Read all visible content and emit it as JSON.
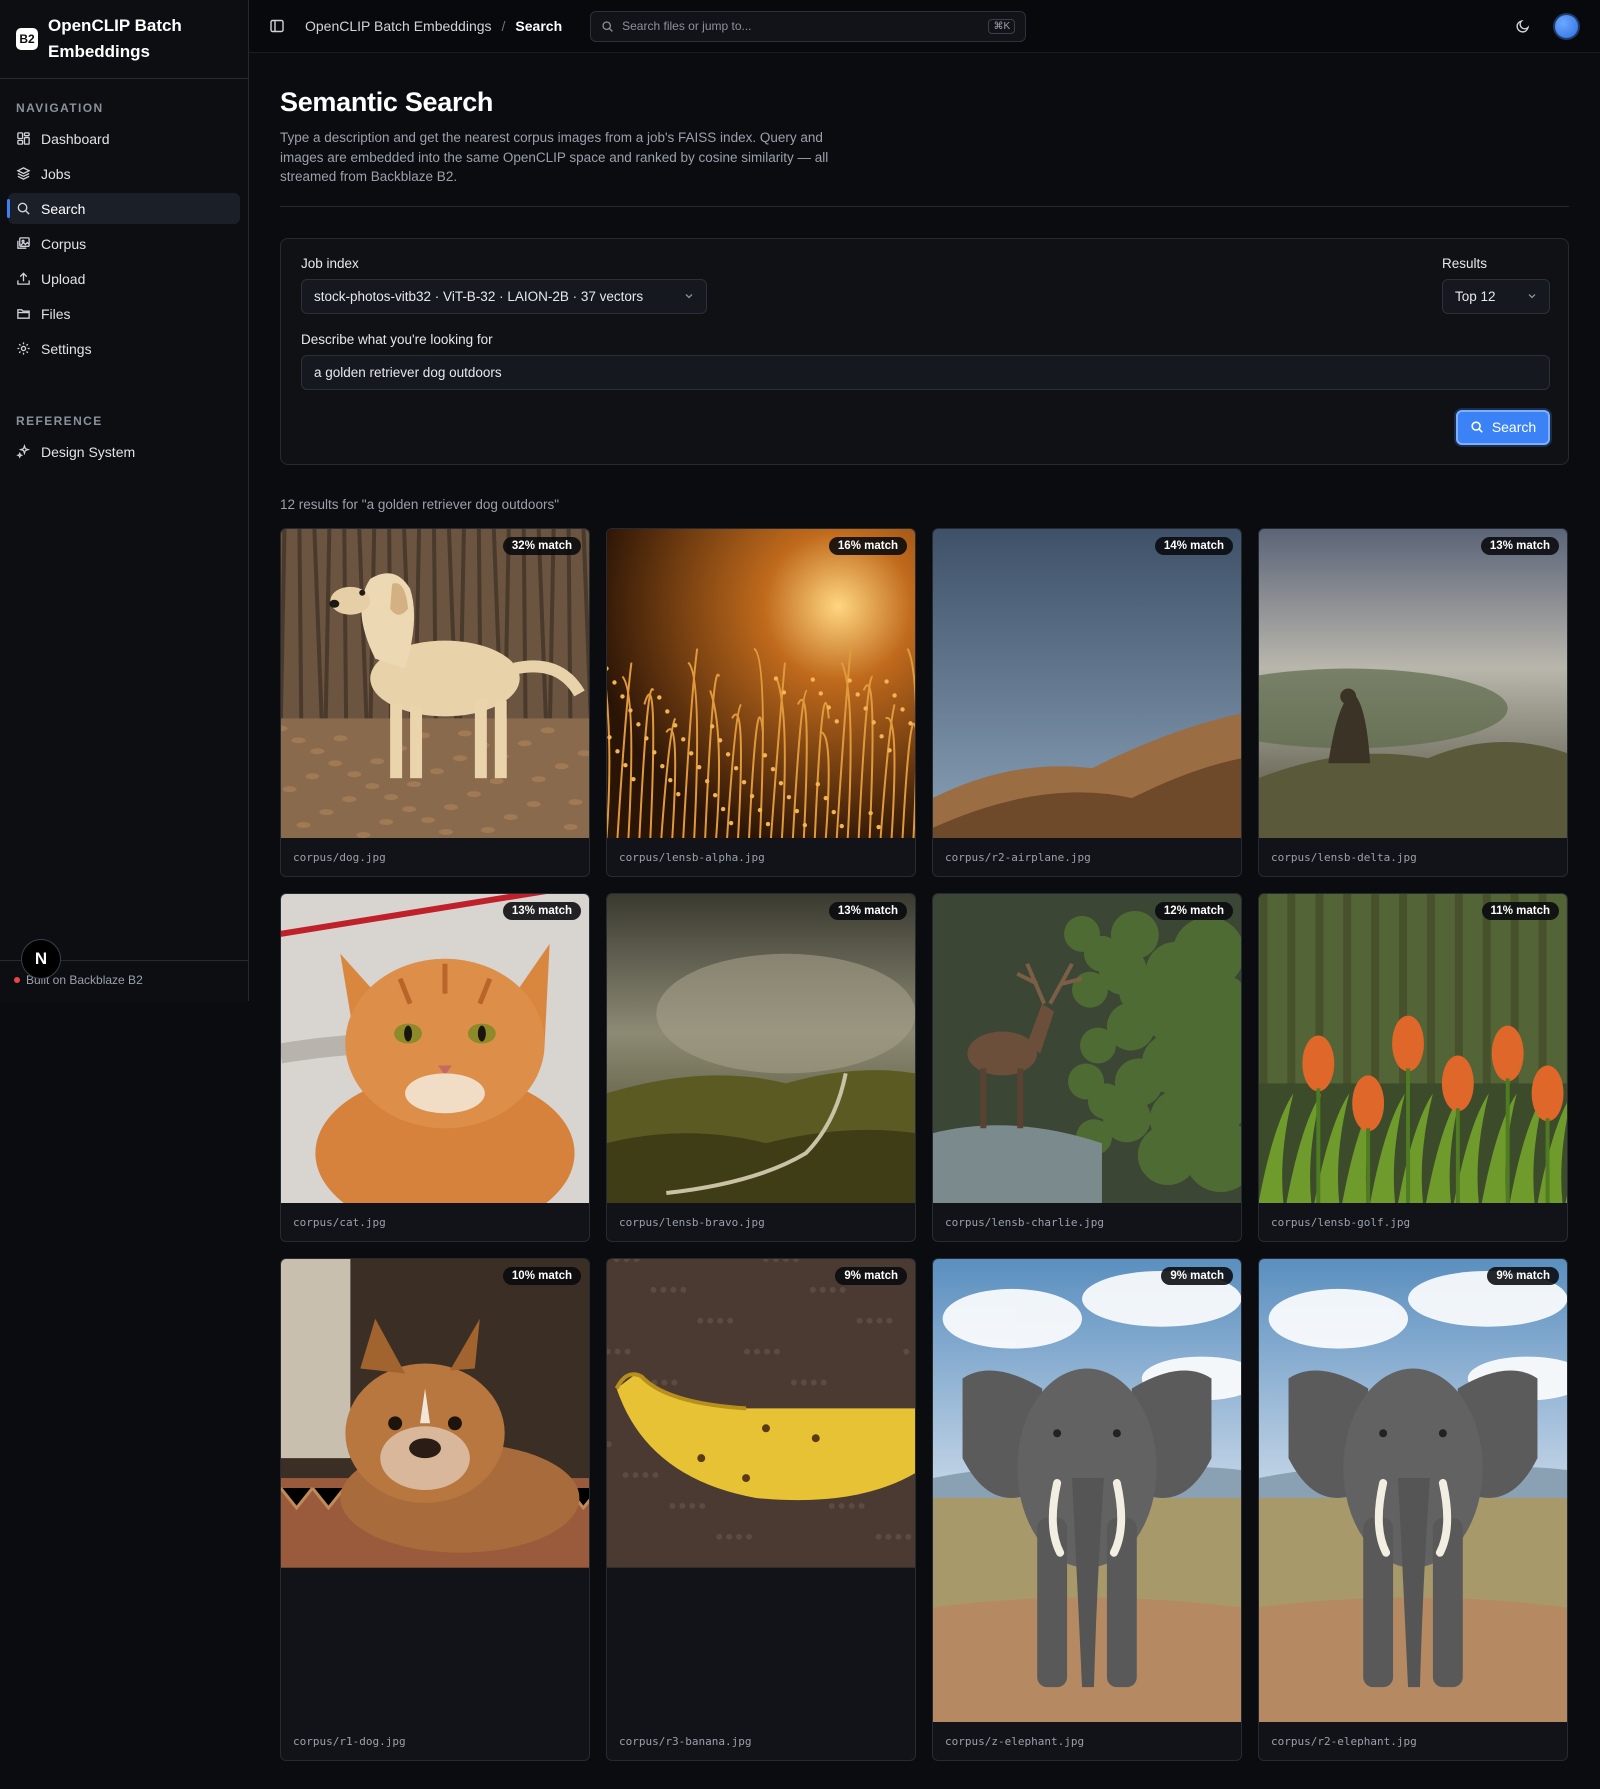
{
  "brand": {
    "logo": "B2",
    "name": "OpenCLIP Batch Embeddings"
  },
  "sidebar": {
    "nav_heading": "NAVIGATION",
    "items": [
      {
        "label": "Dashboard",
        "icon": "dashboard-icon"
      },
      {
        "label": "Jobs",
        "icon": "layers-icon"
      },
      {
        "label": "Search",
        "icon": "search-icon",
        "active": true
      },
      {
        "label": "Corpus",
        "icon": "images-icon"
      },
      {
        "label": "Upload",
        "icon": "upload-icon"
      },
      {
        "label": "Files",
        "icon": "folder-icon"
      },
      {
        "label": "Settings",
        "icon": "gear-icon"
      }
    ],
    "ref_heading": "REFERENCE",
    "ref_items": [
      {
        "label": "Design System",
        "icon": "sparkle-icon"
      }
    ],
    "footer": "Built on Backblaze B2",
    "floating_badge": "N"
  },
  "topbar": {
    "breadcrumb_root": "OpenCLIP Batch Embeddings",
    "breadcrumb_sep": "/",
    "breadcrumb_current": "Search",
    "search_placeholder": "Search files or jump to...",
    "search_shortcut": "⌘K"
  },
  "page": {
    "title": "Semantic Search",
    "description": "Type a description and get the nearest corpus images from a job's FAISS index. Query and images are embedded into the same OpenCLIP space and ranked by cosine similarity — all streamed from Backblaze B2."
  },
  "form": {
    "job_label": "Job index",
    "job_value": "stock-photos-vitb32 · ViT-B-32 · LAION-2B · 37 vectors",
    "results_label": "Results",
    "results_value": "Top 12",
    "query_label": "Describe what you're looking for",
    "query_value": "a golden retriever dog outdoors",
    "search_button": "Search"
  },
  "results": {
    "count_text": "12 results for \"a golden retriever dog outdoors\"",
    "items": [
      {
        "file": "corpus/dog.jpg",
        "match": "32% match",
        "scene": "dog"
      },
      {
        "file": "corpus/lensb-alpha.jpg",
        "match": "16% match",
        "scene": "grass"
      },
      {
        "file": "corpus/r2-airplane.jpg",
        "match": "14% match",
        "scene": "hills"
      },
      {
        "file": "corpus/lensb-delta.jpg",
        "match": "13% match",
        "scene": "fog"
      },
      {
        "file": "corpus/cat.jpg",
        "match": "13% match",
        "scene": "cat"
      },
      {
        "file": "corpus/lensb-bravo.jpg",
        "match": "13% match",
        "scene": "valley"
      },
      {
        "file": "corpus/lensb-charlie.jpg",
        "match": "12% match",
        "scene": "moose"
      },
      {
        "file": "corpus/lensb-golf.jpg",
        "match": "11% match",
        "scene": "tulips"
      },
      {
        "file": "corpus/r1-dog.jpg",
        "match": "10% match",
        "scene": "bulldog"
      },
      {
        "file": "corpus/r3-banana.jpg",
        "match": "9% match",
        "scene": "banana"
      },
      {
        "file": "corpus/z-elephant.jpg",
        "match": "9% match",
        "scene": "elephant"
      },
      {
        "file": "corpus/r2-elephant.jpg",
        "match": "9% match",
        "scene": "elephant"
      }
    ]
  },
  "colors": {
    "accent": "#3b82f6",
    "background": "#0a0c10",
    "status_dot": "#ef4444"
  }
}
